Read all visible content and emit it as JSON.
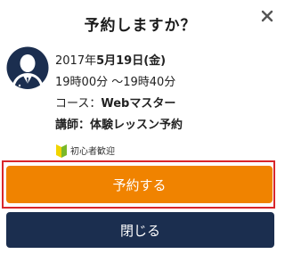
{
  "dialog": {
    "title": "予約しますか？",
    "close_icon": "close-icon"
  },
  "lesson": {
    "date_prefix": "2017年",
    "date_main": "5月19日(金)",
    "time": "19時00分 ～19時40分",
    "course_label": "コース：",
    "course_value": "Webマスター",
    "instructor_label": "講師：",
    "instructor_value": "体験レッスン予約",
    "avatar_icon": "user-avatar-icon"
  },
  "badge": {
    "icon": "beginner-mark-icon",
    "label": "初心者歓迎"
  },
  "buttons": {
    "reserve_label": "予約する",
    "close_label": "閉じる"
  },
  "colors": {
    "reserve_button": "#f08300",
    "close_button": "#1b2e4f",
    "highlight_border": "#d9262a",
    "beginner_mark_green": "#7ab929",
    "beginner_mark_yellow": "#f1d400",
    "avatar_navy": "#1b2e4f"
  }
}
